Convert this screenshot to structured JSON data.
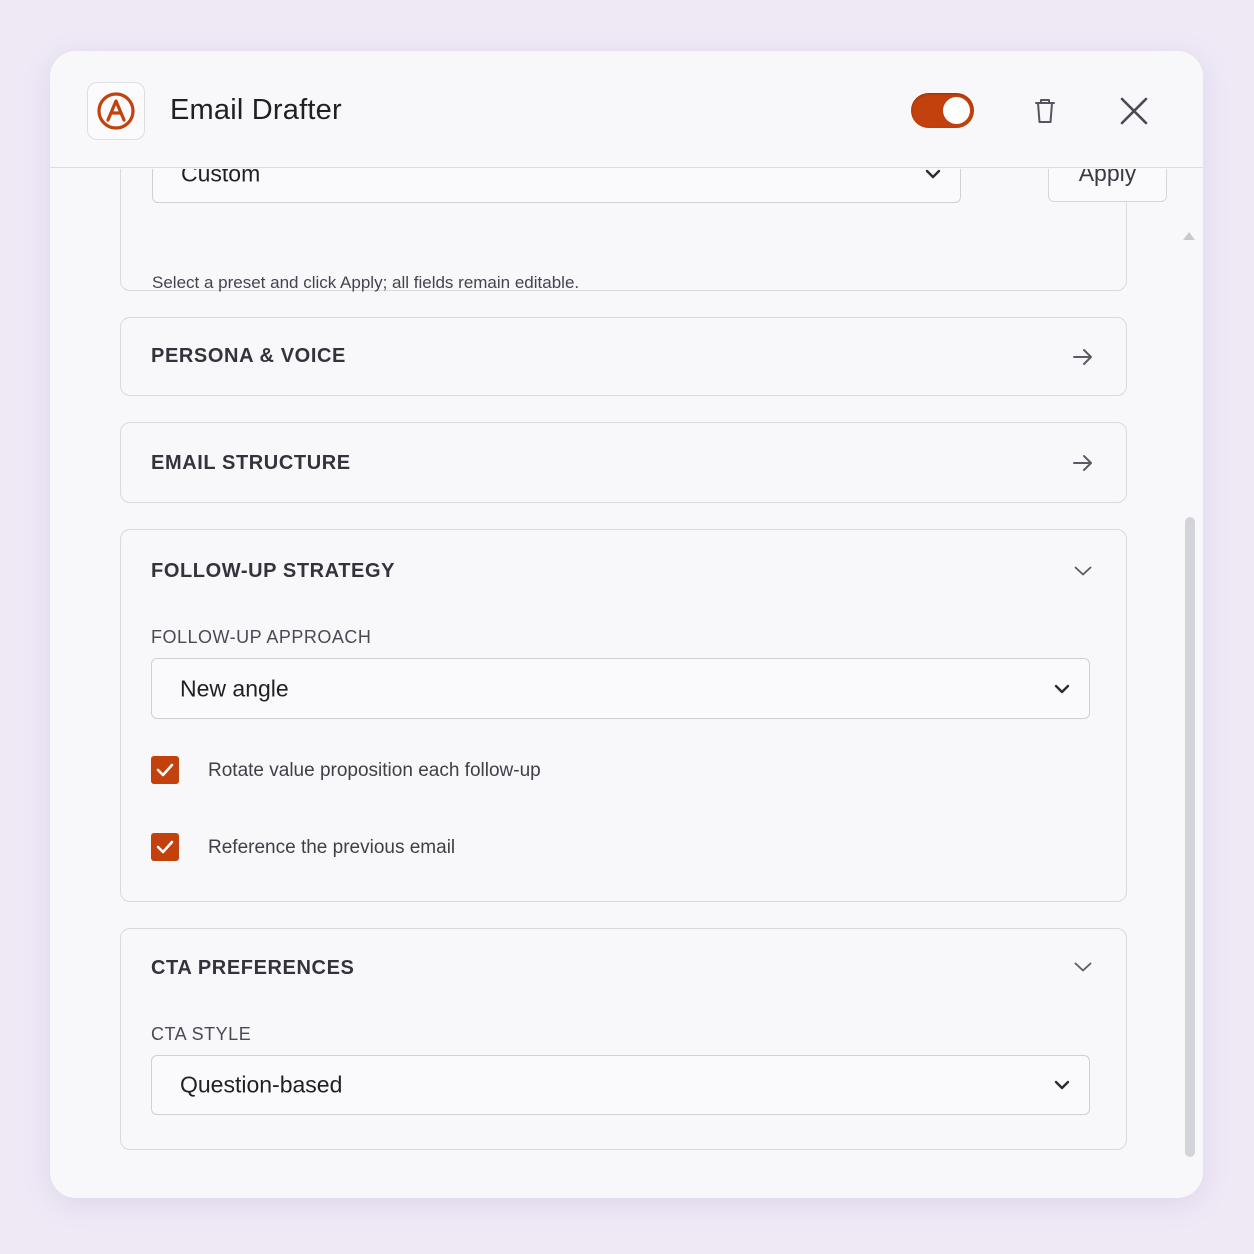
{
  "header": {
    "title": "Email Drafter",
    "logo_icon": "circle-a-logo-icon",
    "toggle_state": "on",
    "accent_color": "#c2410c"
  },
  "preset": {
    "selected": "Custom",
    "apply_label": "Apply",
    "hint": "Select a preset and click Apply; all fields remain editable."
  },
  "sections": {
    "persona": {
      "title": "PERSONA & VOICE",
      "state": "collapsed"
    },
    "structure": {
      "title": "EMAIL STRUCTURE",
      "state": "collapsed"
    },
    "followup": {
      "title": "FOLLOW-UP STRATEGY",
      "approach_label": "FOLLOW-UP APPROACH",
      "approach_value": "New angle",
      "checkbox1_label": "Rotate value proposition each follow-up",
      "checkbox1_checked": true,
      "checkbox2_label": "Reference the previous email",
      "checkbox2_checked": true
    },
    "cta": {
      "title": "CTA PREFERENCES",
      "style_label": "CTA STYLE",
      "style_value": "Question-based"
    }
  }
}
